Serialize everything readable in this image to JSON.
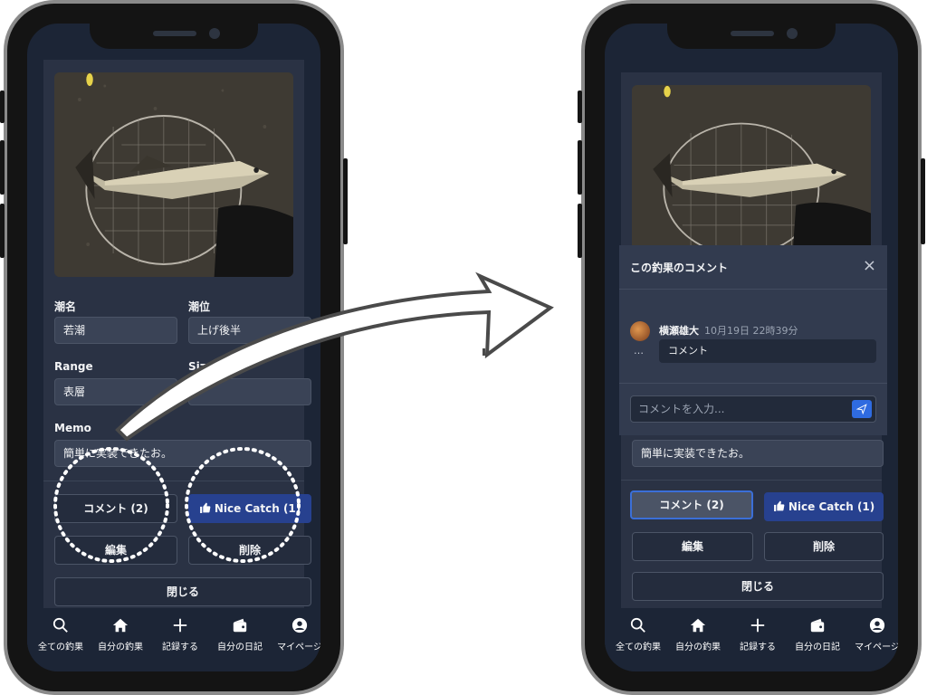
{
  "left_phone": {
    "fields": {
      "tide_name_label": "潮名",
      "tide_name_value": "若潮",
      "tide_level_label": "潮位",
      "tide_level_value": "上げ後半",
      "range_label": "Range",
      "range_value": "表層",
      "size_label": "Size",
      "size_value": "",
      "memo_label": "Memo",
      "memo_value": "簡単に実装できたお。"
    },
    "buttons": {
      "comment": "コメント (2)",
      "nice_catch": "Nice Catch (1)",
      "edit": "編集",
      "delete": "削除",
      "close": "閉じる"
    }
  },
  "right_phone": {
    "modal": {
      "title": "この釣果のコメント",
      "close_icon": "×",
      "comment_user": "横瀬雄大",
      "comment_time": "10月19日 22時39分",
      "comment_text": "コメント",
      "more": "…",
      "input_placeholder": "コメントを入力..."
    },
    "memo_value": "簡単に実装できたお。",
    "buttons": {
      "comment": "コメント (2)",
      "nice_catch": "Nice Catch (1)",
      "edit": "編集",
      "delete": "削除",
      "close": "閉じる"
    }
  },
  "nav": [
    {
      "icon": "search-icon",
      "label": "全ての釣果"
    },
    {
      "icon": "home-icon",
      "label": "自分の釣果"
    },
    {
      "icon": "plus-icon",
      "label": "記録する"
    },
    {
      "icon": "wallet-icon",
      "label": "自分の日記"
    },
    {
      "icon": "user-icon",
      "label": "マイページ"
    }
  ],
  "colors": {
    "screen_bg": "#1c2536",
    "card_bg": "#2a3244",
    "primary": "#27418f",
    "send": "#2f6be0"
  }
}
